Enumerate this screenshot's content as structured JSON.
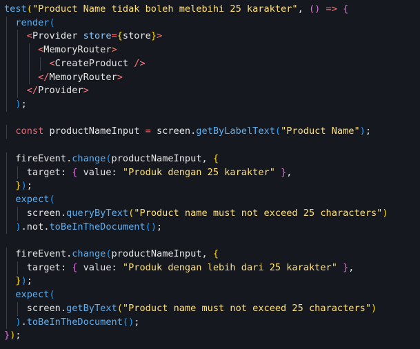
{
  "editor": {
    "lines": [
      [
        [
          "fn",
          "test"
        ],
        [
          "b1",
          "("
        ],
        [
          "str",
          "\"Product Name tidak boleh melebihi 25 karakter\""
        ],
        [
          "punc",
          ", "
        ],
        [
          "b2",
          "()"
        ],
        [
          "op",
          " => "
        ],
        [
          "b2",
          "{"
        ]
      ],
      [
        [
          "punc",
          "  "
        ],
        [
          "fn",
          "render"
        ],
        [
          "b3",
          "("
        ]
      ],
      [
        [
          "punc",
          "    "
        ],
        [
          "jsxbr",
          "<"
        ],
        [
          "tag",
          "Provider"
        ],
        [
          "punc",
          " "
        ],
        [
          "attr",
          "store"
        ],
        [
          "op",
          "="
        ],
        [
          "b1",
          "{"
        ],
        [
          "ident",
          "store"
        ],
        [
          "b1",
          "}"
        ],
        [
          "jsxbr",
          ">"
        ]
      ],
      [
        [
          "punc",
          "      "
        ],
        [
          "jsxbr",
          "<"
        ],
        [
          "tag",
          "MemoryRouter"
        ],
        [
          "jsxbr",
          ">"
        ]
      ],
      [
        [
          "punc",
          "        "
        ],
        [
          "jsxbr",
          "<"
        ],
        [
          "tag",
          "CreateProduct"
        ],
        [
          "punc",
          " "
        ],
        [
          "jsxbr",
          "/>"
        ]
      ],
      [
        [
          "punc",
          "      "
        ],
        [
          "jsxbr",
          "</"
        ],
        [
          "tag",
          "MemoryRouter"
        ],
        [
          "jsxbr",
          ">"
        ]
      ],
      [
        [
          "punc",
          "    "
        ],
        [
          "jsxbr",
          "</"
        ],
        [
          "tag",
          "Provider"
        ],
        [
          "jsxbr",
          ">"
        ]
      ],
      [
        [
          "punc",
          "  "
        ],
        [
          "b3",
          ")"
        ],
        [
          "punc",
          ";"
        ]
      ],
      [
        [
          "punc",
          ""
        ]
      ],
      [
        [
          "punc",
          "  "
        ],
        [
          "kw",
          "const"
        ],
        [
          "punc",
          " "
        ],
        [
          "ident",
          "productNameInput"
        ],
        [
          "op",
          " = "
        ],
        [
          "ident",
          "screen"
        ],
        [
          "punc",
          "."
        ],
        [
          "fn",
          "getByLabelText"
        ],
        [
          "b3",
          "("
        ],
        [
          "str",
          "\"Product Name\""
        ],
        [
          "b3",
          ")"
        ],
        [
          "punc",
          ";"
        ]
      ],
      [
        [
          "punc",
          ""
        ]
      ],
      [
        [
          "punc",
          "  "
        ],
        [
          "ident",
          "fireEvent"
        ],
        [
          "punc",
          "."
        ],
        [
          "fn",
          "change"
        ],
        [
          "b3",
          "("
        ],
        [
          "ident",
          "productNameInput"
        ],
        [
          "punc",
          ", "
        ],
        [
          "b1",
          "{"
        ]
      ],
      [
        [
          "punc",
          "    "
        ],
        [
          "ident",
          "target"
        ],
        [
          "punc",
          ": "
        ],
        [
          "b2",
          "{"
        ],
        [
          "punc",
          " "
        ],
        [
          "ident",
          "value"
        ],
        [
          "punc",
          ": "
        ],
        [
          "str",
          "\"Produk dengan 25 karakter\""
        ],
        [
          "punc",
          " "
        ],
        [
          "b2",
          "}"
        ],
        [
          "punc",
          ","
        ]
      ],
      [
        [
          "punc",
          "  "
        ],
        [
          "b1",
          "}"
        ],
        [
          "b3",
          ")"
        ],
        [
          "punc",
          ";"
        ]
      ],
      [
        [
          "punc",
          "  "
        ],
        [
          "fn",
          "expect"
        ],
        [
          "b3",
          "("
        ]
      ],
      [
        [
          "punc",
          "    "
        ],
        [
          "ident",
          "screen"
        ],
        [
          "punc",
          "."
        ],
        [
          "fn",
          "queryByText"
        ],
        [
          "b1",
          "("
        ],
        [
          "str",
          "\"Product name must not exceed 25 characters\""
        ],
        [
          "b1",
          ")"
        ]
      ],
      [
        [
          "punc",
          "  "
        ],
        [
          "b3",
          ")"
        ],
        [
          "punc",
          "."
        ],
        [
          "ident",
          "not"
        ],
        [
          "punc",
          "."
        ],
        [
          "fn",
          "toBeInTheDocument"
        ],
        [
          "b3",
          "()"
        ],
        [
          "punc",
          ";"
        ]
      ],
      [
        [
          "punc",
          ""
        ]
      ],
      [
        [
          "punc",
          "  "
        ],
        [
          "ident",
          "fireEvent"
        ],
        [
          "punc",
          "."
        ],
        [
          "fn",
          "change"
        ],
        [
          "b3",
          "("
        ],
        [
          "ident",
          "productNameInput"
        ],
        [
          "punc",
          ", "
        ],
        [
          "b1",
          "{"
        ]
      ],
      [
        [
          "punc",
          "    "
        ],
        [
          "ident",
          "target"
        ],
        [
          "punc",
          ": "
        ],
        [
          "b2",
          "{"
        ],
        [
          "punc",
          " "
        ],
        [
          "ident",
          "value"
        ],
        [
          "punc",
          ": "
        ],
        [
          "str",
          "\"Produk dengan lebih dari 25 karakter\""
        ],
        [
          "punc",
          " "
        ],
        [
          "b2",
          "}"
        ],
        [
          "punc",
          ","
        ]
      ],
      [
        [
          "punc",
          "  "
        ],
        [
          "b1",
          "}"
        ],
        [
          "b3",
          ")"
        ],
        [
          "punc",
          ";"
        ]
      ],
      [
        [
          "punc",
          "  "
        ],
        [
          "fn",
          "expect"
        ],
        [
          "b3",
          "("
        ]
      ],
      [
        [
          "punc",
          "    "
        ],
        [
          "ident",
          "screen"
        ],
        [
          "punc",
          "."
        ],
        [
          "fn",
          "getByText"
        ],
        [
          "b1",
          "("
        ],
        [
          "str",
          "\"Product name must not exceed 25 characters\""
        ],
        [
          "b1",
          ")"
        ]
      ],
      [
        [
          "punc",
          "  "
        ],
        [
          "b3",
          ")"
        ],
        [
          "punc",
          "."
        ],
        [
          "fn",
          "toBeInTheDocument"
        ],
        [
          "b3",
          "()"
        ],
        [
          "punc",
          ";"
        ]
      ],
      [
        [
          "b2",
          "}"
        ],
        [
          "b1",
          ")"
        ],
        [
          "punc",
          ";"
        ]
      ]
    ]
  }
}
